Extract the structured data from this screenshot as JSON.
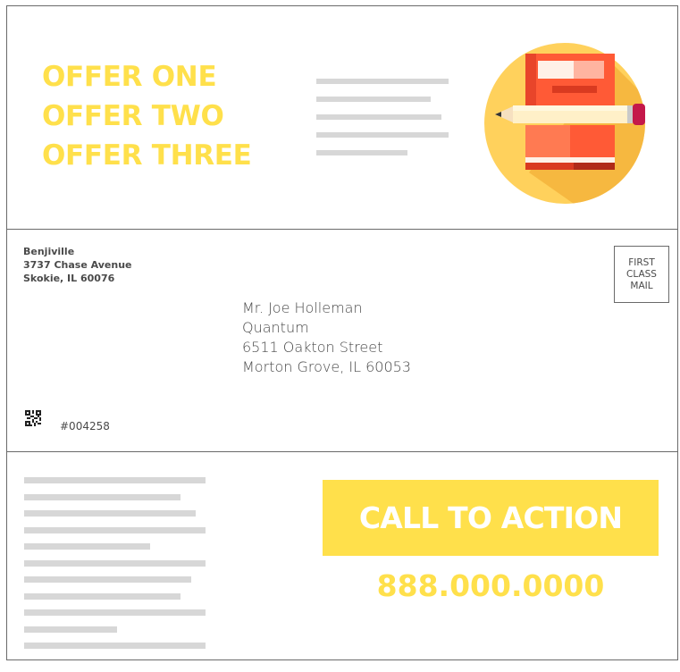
{
  "offers": [
    "OFFER ONE",
    "OFFER TWO",
    "OFFER THREE"
  ],
  "illustration": {
    "icon": "book-and-pencil-icon"
  },
  "sender": {
    "name": "Benjiville",
    "street": "3737 Chase Avenue",
    "city": "Skokie, IL 60076"
  },
  "postage": {
    "lines": [
      "FIRST",
      "CLASS",
      "MAIL"
    ]
  },
  "recipient": {
    "name": "Mr. Joe Holleman",
    "company": "Quantum",
    "street": "6511 Oakton Street",
    "city": "Morton Grove, IL 60053"
  },
  "tracking": {
    "code": "#004258",
    "icon": "qr-code-icon"
  },
  "cta": {
    "label": "CALL TO ACTION",
    "phone": "888.000.0000"
  },
  "colors": {
    "accent": "#FFE04B",
    "text": "#4a4a4a",
    "placeholder": "#d7d7d7",
    "border": "#6a6a6a"
  }
}
